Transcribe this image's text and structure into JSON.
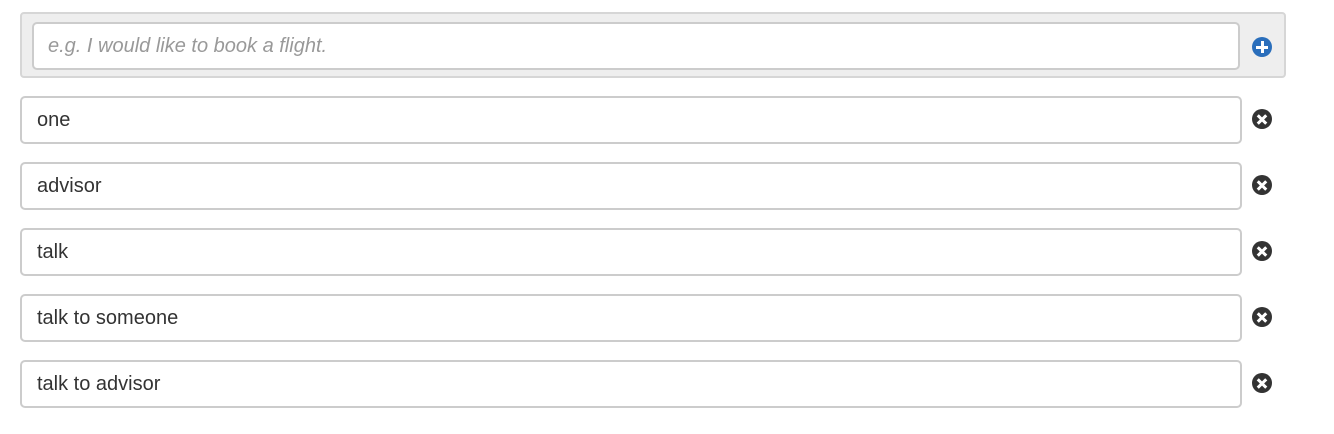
{
  "new_example": {
    "placeholder": "e.g. I would like to book a flight.",
    "value": "",
    "add_icon": "plus-circle-icon",
    "accent_color": "#2a6ebb"
  },
  "examples": [
    {
      "text": "one",
      "remove_icon": "remove-circle-icon"
    },
    {
      "text": "advisor",
      "remove_icon": "remove-circle-icon"
    },
    {
      "text": "talk",
      "remove_icon": "remove-circle-icon"
    },
    {
      "text": "talk to someone",
      "remove_icon": "remove-circle-icon"
    },
    {
      "text": "talk to advisor",
      "remove_icon": "remove-circle-icon"
    }
  ]
}
